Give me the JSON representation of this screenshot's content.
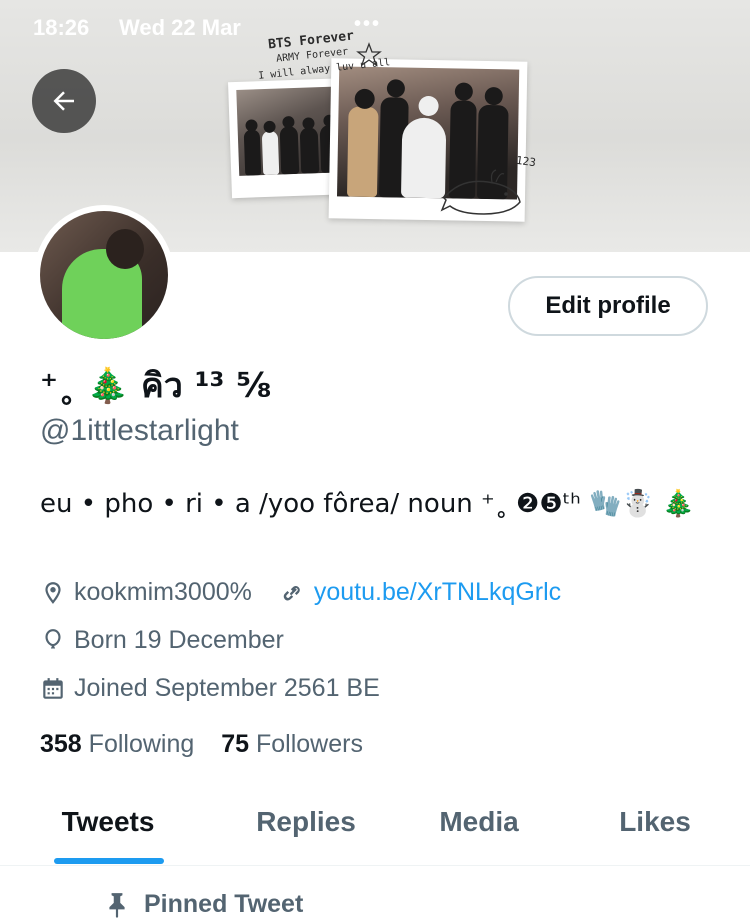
{
  "status_bar": {
    "time": "18:26",
    "date": "Wed 22 Mar",
    "dots": "•••"
  },
  "banner": {
    "text_line1": "BTS Forever",
    "text_line2": "ARMY Forever",
    "text_line3": "I will alway luv u all",
    "text_line4": "123"
  },
  "profile": {
    "edit_button_label": "Edit profile",
    "display_name": "⁺˳ 🎄 คิว ¹³ ⅝",
    "handle": "@1ittlestarlight",
    "bio": "eu • pho • ri • a /yoo fôrea/ noun ⁺˳ ❷❺ᵗʰ 🧤☃️ 🎄",
    "location": "kookmim3000%",
    "website": "youtu.be/XrTNLkqGrlc",
    "birthday": "Born 19 December",
    "joined": "Joined September 2561 BE",
    "following_count": "358",
    "following_label": "Following",
    "followers_count": "75",
    "followers_label": "Followers"
  },
  "tabs": [
    {
      "label": "Tweets",
      "active": true
    },
    {
      "label": "Replies",
      "active": false
    },
    {
      "label": "Media",
      "active": false
    },
    {
      "label": "Likes",
      "active": false
    }
  ],
  "pinned_label": "Pinned Tweet",
  "colors": {
    "accent": "#1d9bf0",
    "secondary_text": "#536471",
    "primary_text": "#0f1419"
  }
}
